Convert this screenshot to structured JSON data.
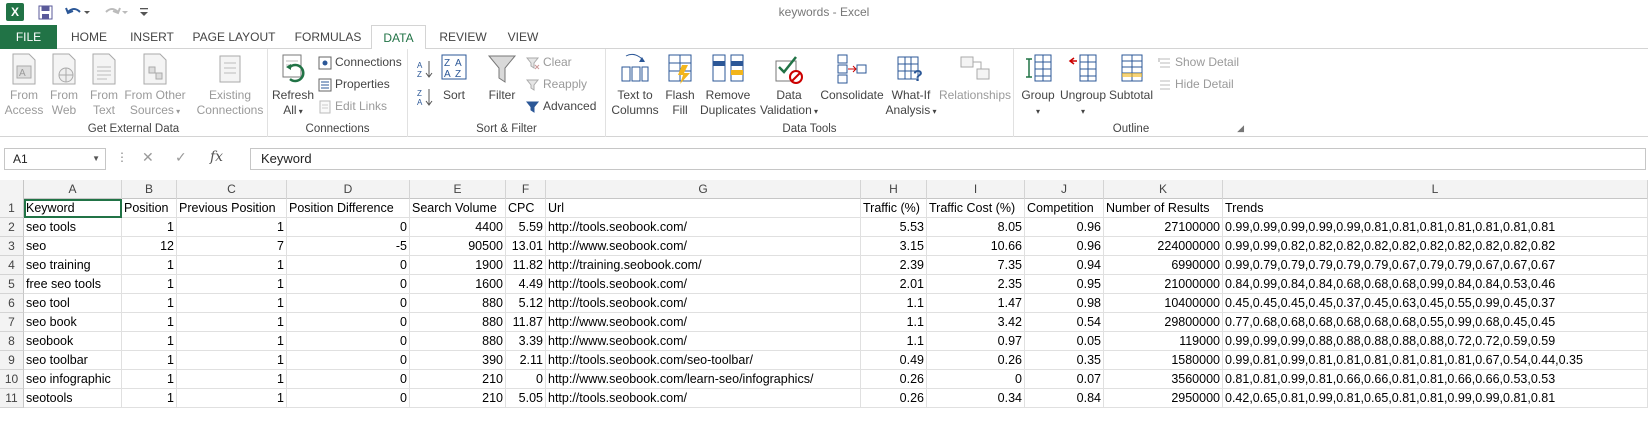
{
  "window": {
    "title": "keywords - Excel"
  },
  "tabs": [
    "FILE",
    "HOME",
    "INSERT",
    "PAGE LAYOUT",
    "FORMULAS",
    "DATA",
    "REVIEW",
    "VIEW"
  ],
  "ribbon": {
    "get_external_data": {
      "label": "Get External Data",
      "from_access": [
        "From",
        "Access"
      ],
      "from_web": [
        "From",
        "Web"
      ],
      "from_text": [
        "From",
        "Text"
      ],
      "from_other": [
        "From Other",
        "Sources"
      ],
      "existing": [
        "Existing",
        "Connections"
      ]
    },
    "connections": {
      "label": "Connections",
      "refresh": [
        "Refresh",
        "All"
      ],
      "connections": "Connections",
      "properties": "Properties",
      "edit_links": "Edit Links"
    },
    "sort_filter": {
      "label": "Sort & Filter",
      "sort": "Sort",
      "filter": "Filter",
      "clear": "Clear",
      "reapply": "Reapply",
      "advanced": "Advanced"
    },
    "data_tools": {
      "label": "Data Tools",
      "text_to_columns": [
        "Text to",
        "Columns"
      ],
      "flash_fill": [
        "Flash",
        "Fill"
      ],
      "remove_duplicates": [
        "Remove",
        "Duplicates"
      ],
      "data_validation": [
        "Data",
        "Validation"
      ],
      "consolidate": "Consolidate",
      "what_if": [
        "What-If",
        "Analysis"
      ],
      "relationships": "Relationships"
    },
    "outline": {
      "label": "Outline",
      "group": "Group",
      "ungroup": "Ungroup",
      "subtotal": "Subtotal",
      "show_detail": "Show Detail",
      "hide_detail": "Hide Detail"
    }
  },
  "formula_bar": {
    "name_box": "A1",
    "content": "Keyword"
  },
  "sheet": {
    "columns": [
      "A",
      "B",
      "C",
      "D",
      "E",
      "F",
      "G",
      "H",
      "I",
      "J",
      "K",
      "L"
    ],
    "header_row": [
      "Keyword",
      "Position",
      "Previous Position",
      "Position Difference",
      "Search Volume",
      "CPC",
      "Url",
      "Traffic (%)",
      "Traffic Cost (%)",
      "Competition",
      "Number of Results",
      "Trends"
    ],
    "rows": [
      [
        "seo tools",
        "1",
        "1",
        "0",
        "4400",
        "5.59",
        "http://tools.seobook.com/",
        "5.53",
        "8.05",
        "0.96",
        "27100000",
        "0.99,0.99,0.99,0.99,0.99,0.81,0.81,0.81,0.81,0.81,0.81,0.81"
      ],
      [
        "seo",
        "12",
        "7",
        "-5",
        "90500",
        "13.01",
        "http://www.seobook.com/",
        "3.15",
        "10.66",
        "0.96",
        "224000000",
        "0.99,0.99,0.82,0.82,0.82,0.82,0.82,0.82,0.82,0.82,0.82,0.82"
      ],
      [
        "seo training",
        "1",
        "1",
        "0",
        "1900",
        "11.82",
        "http://training.seobook.com/",
        "2.39",
        "7.35",
        "0.94",
        "6990000",
        "0.99,0.79,0.79,0.79,0.79,0.79,0.67,0.79,0.79,0.67,0.67,0.67"
      ],
      [
        "free seo tools",
        "1",
        "1",
        "0",
        "1600",
        "4.49",
        "http://tools.seobook.com/",
        "2.01",
        "2.35",
        "0.95",
        "21000000",
        "0.84,0.99,0.84,0.84,0.68,0.68,0.68,0.99,0.84,0.84,0.53,0.46"
      ],
      [
        "seo tool",
        "1",
        "1",
        "0",
        "880",
        "5.12",
        "http://tools.seobook.com/",
        "1.1",
        "1.47",
        "0.98",
        "10400000",
        "0.45,0.45,0.45,0.45,0.37,0.45,0.63,0.45,0.55,0.99,0.45,0.37"
      ],
      [
        "seo book",
        "1",
        "1",
        "0",
        "880",
        "11.87",
        "http://www.seobook.com/",
        "1.1",
        "3.42",
        "0.54",
        "29800000",
        "0.77,0.68,0.68,0.68,0.68,0.68,0.68,0.55,0.99,0.68,0.45,0.45"
      ],
      [
        "seobook",
        "1",
        "1",
        "0",
        "880",
        "3.39",
        "http://www.seobook.com/",
        "1.1",
        "0.97",
        "0.05",
        "119000",
        "0.99,0.99,0.99,0.88,0.88,0.88,0.88,0.88,0.72,0.72,0.59,0.59"
      ],
      [
        "seo toolbar",
        "1",
        "1",
        "0",
        "390",
        "2.11",
        "http://tools.seobook.com/seo-toolbar/",
        "0.49",
        "0.26",
        "0.35",
        "1580000",
        "0.99,0.81,0.99,0.81,0.81,0.81,0.81,0.81,0.81,0.67,0.54,0.44,0.35"
      ],
      [
        "seo infographic",
        "1",
        "1",
        "0",
        "210",
        "0",
        "http://www.seobook.com/learn-seo/infographics/",
        "0.26",
        "0",
        "0.07",
        "3560000",
        "0.81,0.81,0.99,0.81,0.66,0.66,0.81,0.81,0.66,0.66,0.53,0.53"
      ],
      [
        "seotools",
        "1",
        "1",
        "0",
        "210",
        "5.05",
        "http://tools.seobook.com/",
        "0.26",
        "0.34",
        "0.84",
        "2950000",
        "0.42,0.65,0.81,0.99,0.81,0.65,0.81,0.81,0.99,0.99,0.81,0.81"
      ]
    ]
  }
}
